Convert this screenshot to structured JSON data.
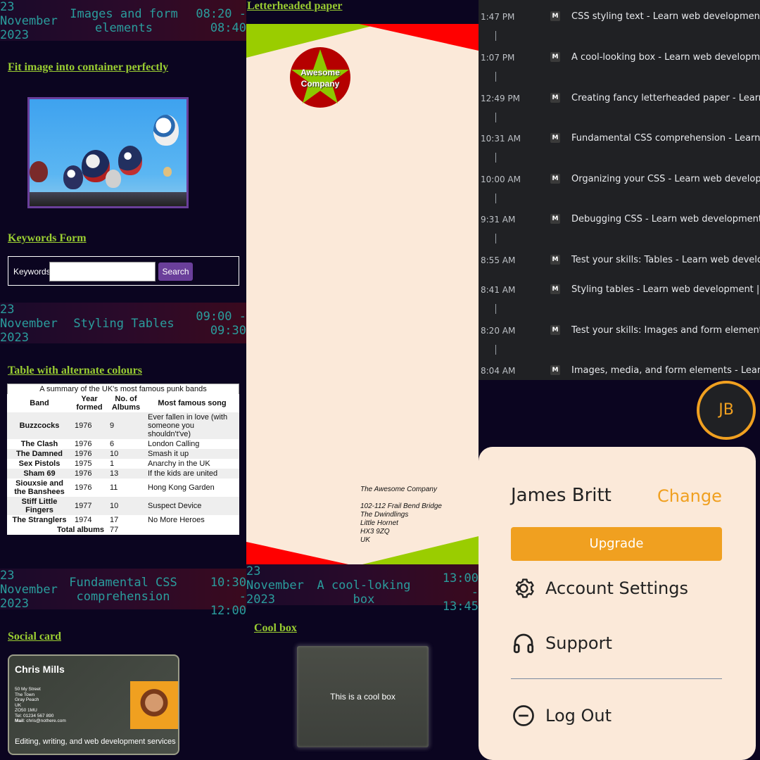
{
  "panel1": {
    "banner1": {
      "date": "23 November 2023",
      "title": "Images and form elements",
      "time": "08:20 - 08:40"
    },
    "heading_fit": "Fit image into container perfectly",
    "heading_keywords": "Keywords Form",
    "form": {
      "label": "Keywords",
      "input_value": "",
      "button": "Search"
    },
    "banner2": {
      "date": "23 November 2023",
      "title": "Styling Tables",
      "time": "09:00 - 09:30"
    },
    "heading_table": "Table with alternate colours",
    "table": {
      "caption": "A summary of the UK's most famous punk bands",
      "headers": [
        "Band",
        "Year formed",
        "No. of Albums",
        "Most famous song"
      ],
      "rows": [
        [
          "Buzzcocks",
          "1976",
          "9",
          "Ever fallen in love (with someone you shouldn't've)"
        ],
        [
          "The Clash",
          "1976",
          "6",
          "London Calling"
        ],
        [
          "The Damned",
          "1976",
          "10",
          "Smash it up"
        ],
        [
          "Sex Pistols",
          "1975",
          "1",
          "Anarchy in the UK"
        ],
        [
          "Sham 69",
          "1976",
          "13",
          "If the kids are united"
        ],
        [
          "Siouxsie and the Banshees",
          "1976",
          "11",
          "Hong Kong Garden"
        ],
        [
          "Stiff Little Fingers",
          "1977",
          "10",
          "Suspect Device"
        ],
        [
          "The Stranglers",
          "1974",
          "17",
          "No More Heroes"
        ]
      ],
      "footer_label": "Total albums",
      "footer_value": "77"
    },
    "banner3": {
      "date": "23 November 2023",
      "title": "Fundamental CSS comprehension",
      "time": "10:30 - 12:00"
    },
    "heading_social": "Social card",
    "card": {
      "name": "Chris Mills",
      "address": [
        "50 My Street",
        "The Town",
        "Gray Peach",
        "UK",
        "ZO50 1MU"
      ],
      "tel_label": "Tel",
      "tel": "01234 567 890",
      "mail_label": "Mail",
      "mail": "chris@nothere.com",
      "tagline": "Editing, writing, and web development services"
    }
  },
  "panel2": {
    "heading_letter": "Letterheaded paper",
    "logo_line1": "Awesome",
    "logo_line2": "Company",
    "address": [
      "The Awesome Company",
      "",
      "102-112 Frail Bend Bridge",
      "The Dwindlings",
      "Little Hornet",
      "HX3 9ZQ",
      "UK"
    ],
    "banner": {
      "date": "23 November 2023",
      "title": "A cool-loking box",
      "time": "13:00 - 13:45"
    },
    "heading_cool": "Cool box",
    "coolbox_text": "This is a cool box",
    "colors": {
      "green": "#9acd00",
      "red": "#ff0000",
      "paper": "#fbe9d9"
    }
  },
  "panel3": {
    "history": [
      {
        "time": "1:47 PM",
        "title": "CSS styling text - Learn web development |"
      },
      {
        "time": "1:07 PM",
        "title": "A cool-looking box - Learn web developme"
      },
      {
        "time": "12:49 PM",
        "title": "Creating fancy letterheaded paper - Learn"
      },
      {
        "time": "10:31 AM",
        "title": "Fundamental CSS comprehension - Learn"
      },
      {
        "time": "10:00 AM",
        "title": "Organizing your CSS - Learn web developm"
      },
      {
        "time": "9:31 AM",
        "title": "Debugging CSS - Learn web development"
      },
      {
        "time": "8:55 AM",
        "title": "Test your skills: Tables - Learn web develop"
      },
      {
        "time": "8:41 AM",
        "title": "Styling tables - Learn web development | M"
      },
      {
        "time": "8:20 AM",
        "title": "Test your skills: Images and form elements"
      },
      {
        "time": "8:04 AM",
        "title": "Images, media, and form elements - Learn"
      }
    ],
    "history_icon_glyph": "M",
    "avatar_initials": "JB",
    "menu": {
      "user_name": "James Britt",
      "change": "Change",
      "upgrade": "Upgrade",
      "account_settings": "Account Settings",
      "support": "Support",
      "log_out": "Log Out"
    },
    "accent": "#f0a020"
  }
}
